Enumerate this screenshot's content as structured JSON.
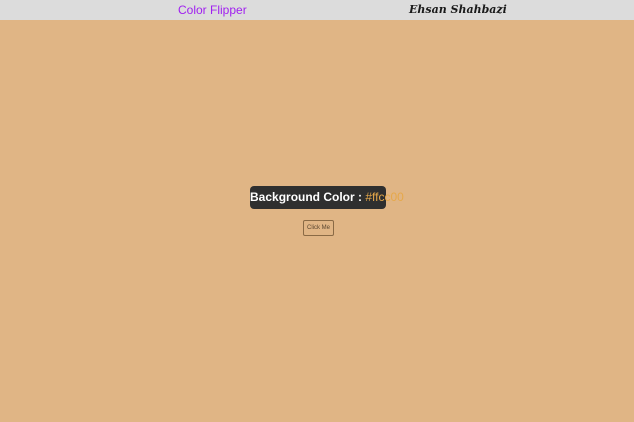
{
  "navbar": {
    "title": "Color Flipper",
    "author": "Ehsan Shahbazi",
    "title_color": "#a020f0",
    "background": "#dcdcdc"
  },
  "main": {
    "background": "#e0b585",
    "label_prefix": "Background Color : ",
    "color_value": "#ffcc00",
    "value_color": "#e6a84a",
    "button_label": "Click Me"
  }
}
